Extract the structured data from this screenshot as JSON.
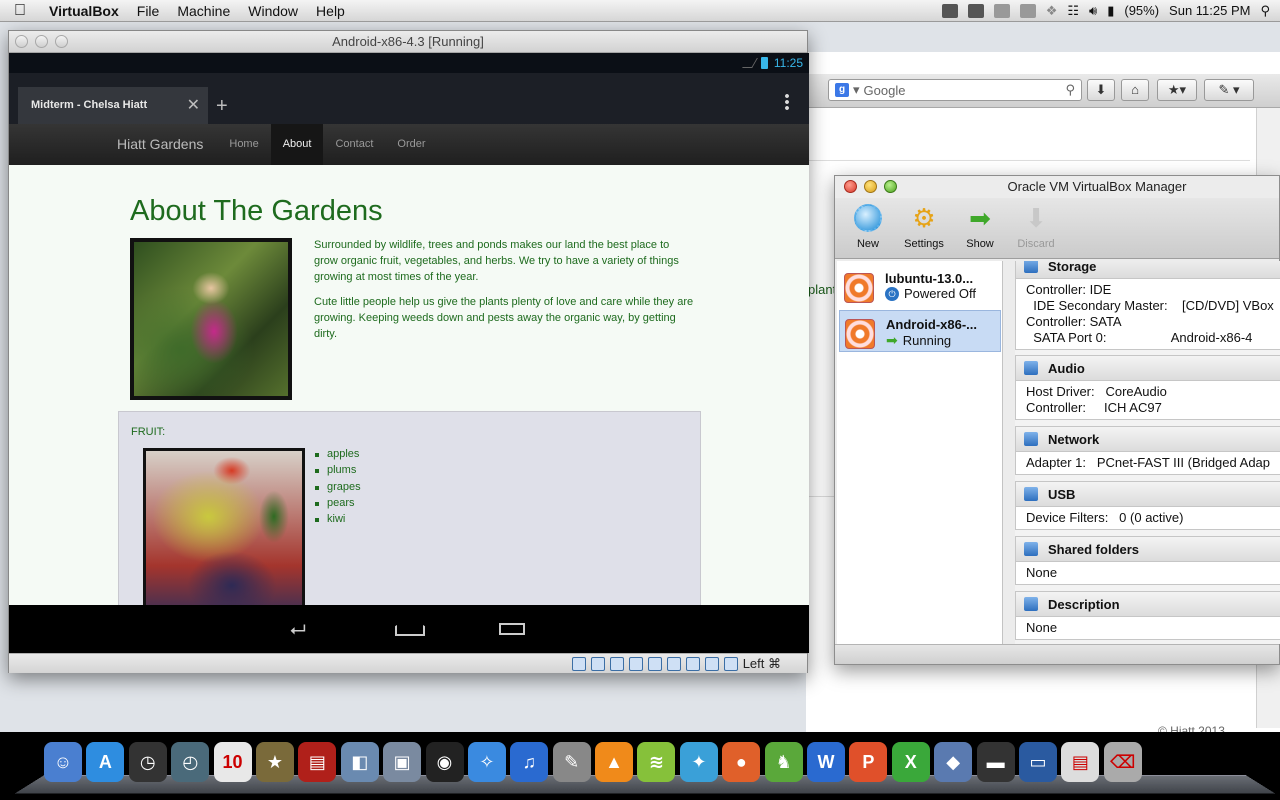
{
  "menubar": {
    "app_name": "VirtualBox",
    "items": [
      "File",
      "Machine",
      "Window",
      "Help"
    ],
    "battery": "(95%)",
    "clock": "Sun 11:25 PM"
  },
  "background_browser": {
    "search_placeholder": "Google",
    "fragment_text": "plant",
    "copyright_text": "© Hiatt 2013"
  },
  "vm_window": {
    "title": "Android-x86-4.3 [Running]",
    "status_time": "11:25",
    "tab_title": "Midterm - Chelsa Hiatt",
    "tab_close": "✕",
    "new_tab": "+",
    "site": {
      "brand": "Hiatt Gardens",
      "nav": [
        "Home",
        "About",
        "Contact",
        "Order"
      ],
      "active_nav": "About",
      "heading": "About The Gardens",
      "paragraph1": "Surrounded by wildlife, trees and ponds makes our land the best place to grow organic fruit, vegetables, and herbs. We try to have a variety of things growing at most times of the year.",
      "paragraph2": "Cute little people help us give the plants plenty of love and care while they are growing. Keeping weeds down and pests away the organic way, by getting dirty.",
      "fruit_label": "FRUIT:",
      "fruits": [
        "apples",
        "plums",
        "grapes",
        "pears",
        "kiwi"
      ]
    },
    "host_key": "Left ⌘"
  },
  "manager": {
    "title": "Oracle VM VirtualBox Manager",
    "toolbar": [
      {
        "label": "New",
        "icon": "new-icon"
      },
      {
        "label": "Settings",
        "icon": "gear-icon"
      },
      {
        "label": "Show",
        "icon": "arrow-right-icon"
      },
      {
        "label": "Discard",
        "icon": "arrow-down-icon"
      }
    ],
    "vms": [
      {
        "name": "lubuntu-13.0...",
        "state": "Powered Off"
      },
      {
        "name": "Android-x86-...",
        "state": "Running"
      }
    ],
    "sections": {
      "storage": {
        "title": "Storage",
        "lines": [
          "Controller: IDE",
          "  IDE Secondary Master:    [CD/DVD] VBox",
          "Controller: SATA",
          "  SATA Port 0:                  Android-x86-4"
        ]
      },
      "audio": {
        "title": "Audio",
        "lines": [
          "Host Driver:   CoreAudio",
          "Controller:     ICH AC97"
        ]
      },
      "network": {
        "title": "Network",
        "lines": [
          "Adapter 1:   PCnet-FAST III (Bridged Adap"
        ]
      },
      "usb": {
        "title": "USB",
        "lines": [
          "Device Filters:   0 (0 active)"
        ]
      },
      "shared": {
        "title": "Shared folders",
        "lines": [
          "None"
        ]
      },
      "description": {
        "title": "Description",
        "lines": [
          "None"
        ]
      }
    }
  },
  "dock": {
    "apps": [
      {
        "icon": "finder-icon",
        "color": "#4a7fd0",
        "glyph": "☺"
      },
      {
        "icon": "app-store-icon",
        "color": "#2e8de0",
        "glyph": "A"
      },
      {
        "icon": "dashboard-icon",
        "color": "#333333",
        "glyph": "◷"
      },
      {
        "icon": "time-machine-icon",
        "color": "#4a6a7a",
        "glyph": "◴"
      },
      {
        "icon": "calendar-icon",
        "color": "#e8e8e8",
        "glyph": "10"
      },
      {
        "icon": "imovie-star-icon",
        "color": "#7a6a3a",
        "glyph": "★"
      },
      {
        "icon": "dvd-player-icon",
        "color": "#b0201a",
        "glyph": "▤"
      },
      {
        "icon": "preview-icon",
        "color": "#6a8ab0",
        "glyph": "◧"
      },
      {
        "icon": "iphoto-icon",
        "color": "#7a8aa0",
        "glyph": "▣"
      },
      {
        "icon": "camera-icon",
        "color": "#222222",
        "glyph": "◉"
      },
      {
        "icon": "safari-icon",
        "color": "#3a8ae0",
        "glyph": "✧"
      },
      {
        "icon": "itunes-icon",
        "color": "#2a6ad0",
        "glyph": "♫"
      },
      {
        "icon": "script-editor-icon",
        "color": "#888888",
        "glyph": "✎"
      },
      {
        "icon": "vlc-icon",
        "color": "#f08a1a",
        "glyph": "▲"
      },
      {
        "icon": "spotify-icon",
        "color": "#86c13a",
        "glyph": "≋"
      },
      {
        "icon": "messenger-icon",
        "color": "#3aa0d8",
        "glyph": "✦"
      },
      {
        "icon": "firefox-icon",
        "color": "#e0602a",
        "glyph": "●"
      },
      {
        "icon": "evernote-icon",
        "color": "#5aa83a",
        "glyph": "♞"
      },
      {
        "icon": "word-icon",
        "color": "#2a6ad0",
        "glyph": "W"
      },
      {
        "icon": "powerpoint-icon",
        "color": "#e0502a",
        "glyph": "P"
      },
      {
        "icon": "excel-icon",
        "color": "#3aa83a",
        "glyph": "X"
      },
      {
        "icon": "virtualbox-icon",
        "color": "#5a7ab0",
        "glyph": "◆"
      },
      {
        "icon": "android-vm-icon",
        "color": "#333333",
        "glyph": "▬"
      },
      {
        "icon": "stacks-folder-icon",
        "color": "#2a5aa0",
        "glyph": "▭"
      },
      {
        "icon": "documents-stack-icon",
        "color": "#dddddd",
        "glyph": "▤"
      },
      {
        "icon": "trash-icon",
        "color": "#aaaaaa",
        "glyph": "⌫"
      }
    ]
  }
}
